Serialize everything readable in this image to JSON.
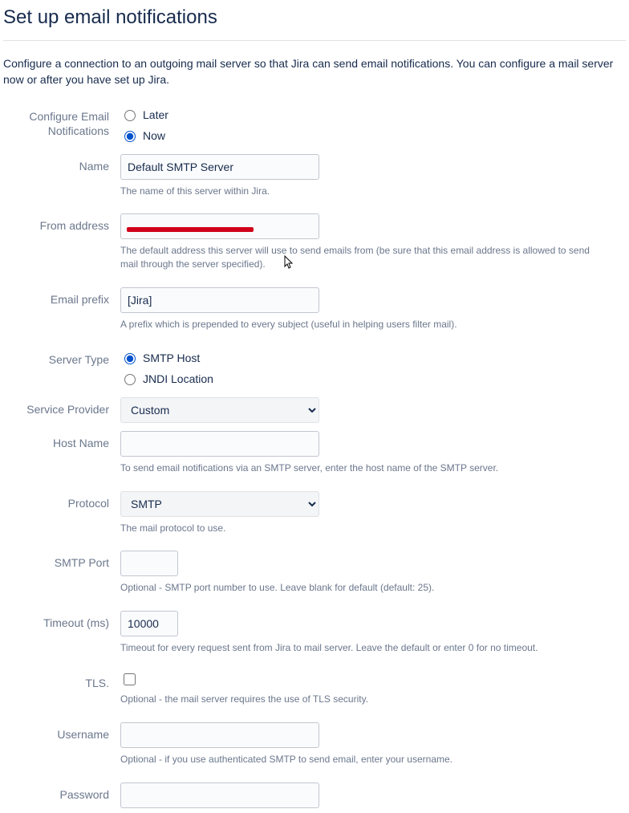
{
  "page": {
    "title": "Set up email notifications",
    "intro": "Configure a connection to an outgoing mail server so that Jira can send email notifications. You can configure a mail server now or after you have set up Jira."
  },
  "labels": {
    "configure": "Configure Email Notifications",
    "name": "Name",
    "from": "From address",
    "prefix": "Email prefix",
    "server_type": "Server Type",
    "service_provider": "Service Provider",
    "host": "Host Name",
    "protocol": "Protocol",
    "port": "SMTP Port",
    "timeout": "Timeout (ms)",
    "tls": "TLS.",
    "username": "Username",
    "password": "Password"
  },
  "radios": {
    "later": "Later",
    "now": "Now",
    "smtp_host": "SMTP Host",
    "jndi": "JNDI Location"
  },
  "values": {
    "name": "Default SMTP Server",
    "from": "",
    "prefix": "[Jira]",
    "service_provider": "Custom",
    "host": "",
    "protocol": "SMTP",
    "port": "",
    "timeout": "10000",
    "username": "",
    "password": ""
  },
  "help": {
    "name": "The name of this server within Jira.",
    "from": "The default address this server will use to send emails from (be sure that this email address is allowed to send mail through the server specified).",
    "prefix": "A prefix which is prepended to every subject (useful in helping users filter mail).",
    "host": "To send email notifications via an SMTP server, enter the host name of the SMTP server.",
    "protocol": "The mail protocol to use.",
    "port": "Optional - SMTP port number to use. Leave blank for default (default: 25).",
    "timeout": "Timeout for every request sent from Jira to mail server. Leave the default or enter 0 for no timeout.",
    "tls": "Optional - the mail server requires the use of TLS security.",
    "username": "Optional - if you use authenticated SMTP to send email, enter your username."
  }
}
